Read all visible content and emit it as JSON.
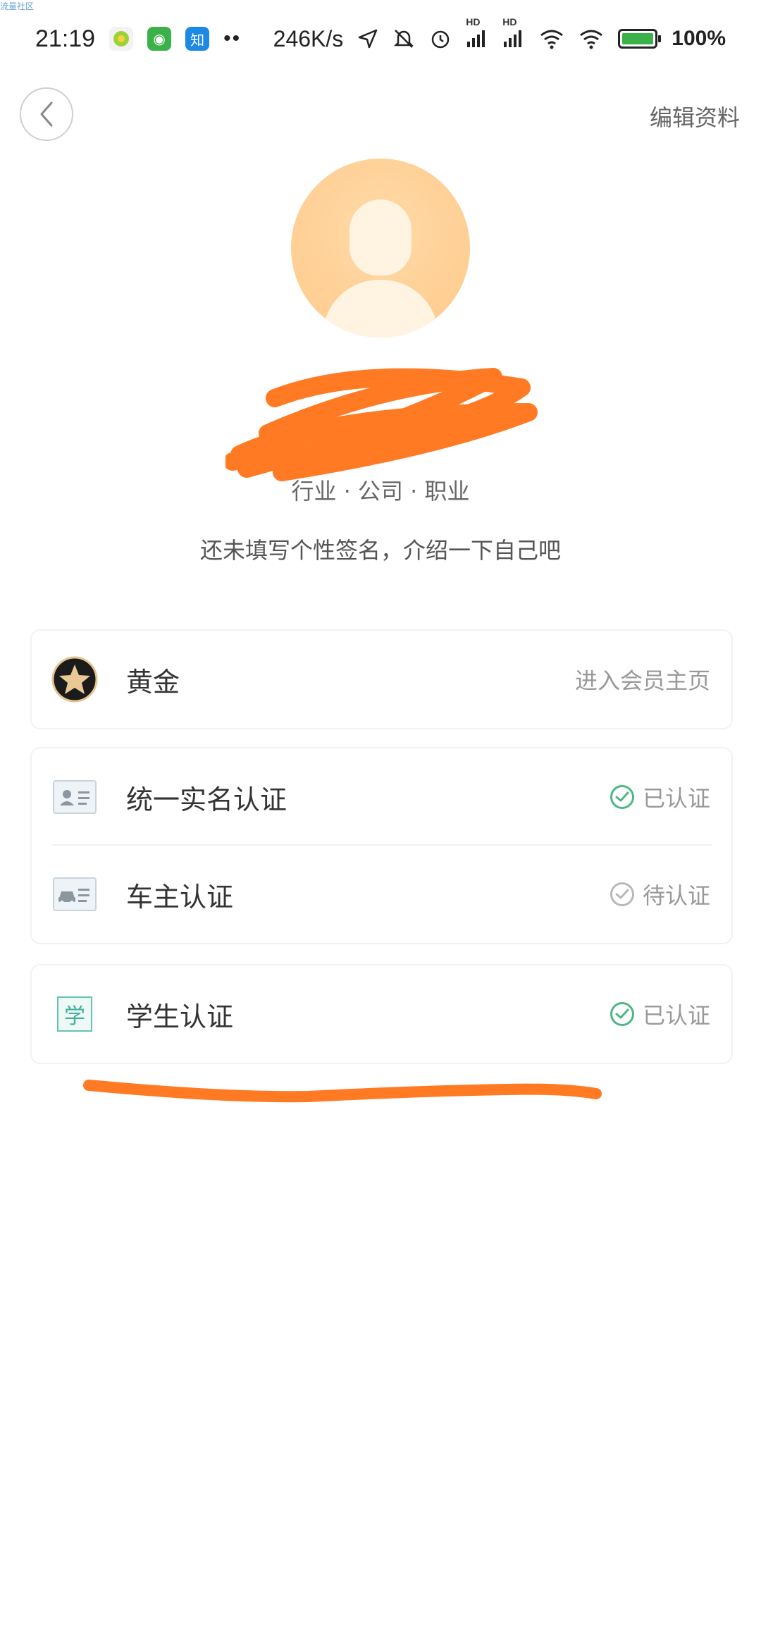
{
  "watermark": "流量社区",
  "status_bar": {
    "time": "21:19",
    "app_icon_2": "◉",
    "app_icon_3": "知",
    "dots": "••",
    "speed": "246K/s",
    "hd1": "HD",
    "hd2": "HD",
    "battery_pct": "100%",
    "battery_level": 1.0
  },
  "header": {
    "back_icon": "chevron-left-icon",
    "edit_label": "编辑资料"
  },
  "profile": {
    "meta": "行业 · 公司 · 职业",
    "signature": "还未填写个性签名，介绍一下自己吧"
  },
  "membership": {
    "label": "黄金",
    "link": "进入会员主页"
  },
  "verifications": [
    {
      "label": "统一实名认证",
      "status": "已认证",
      "verified": true
    },
    {
      "label": "车主认证",
      "status": "待认证",
      "verified": false
    }
  ],
  "student": {
    "icon_text": "学",
    "label": "学生认证",
    "status": "已认证",
    "verified": true
  },
  "colors": {
    "verified": "#4cb782",
    "pending": "#b8b8b8",
    "scribble": "#ff7a22",
    "avatar_bg": "#ffca8a"
  }
}
